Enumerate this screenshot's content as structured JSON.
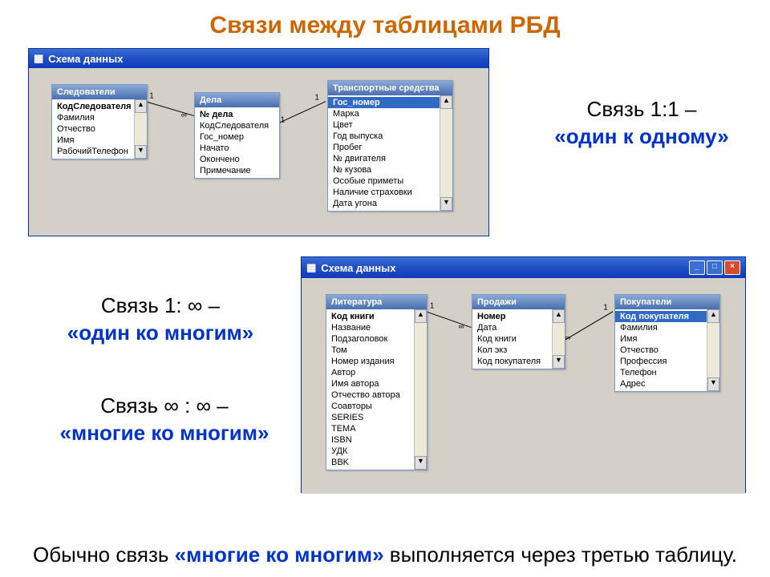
{
  "title": "Связи между таблицами РБД",
  "window1": {
    "title": "Схема данных",
    "tables": {
      "t1": {
        "header": "Следователи",
        "fields": [
          "КодСледователя",
          "Фамилия",
          "Отчество",
          "Имя",
          "РабочийТелефон"
        ]
      },
      "t2": {
        "header": "Дела",
        "fields": [
          "№ дела",
          "КодСледователя",
          "Гос_номер",
          "Начато",
          "Окончено",
          "Примечание"
        ]
      },
      "t3": {
        "header": "Транспортные средства",
        "fields": [
          "Гос_номер",
          "Марка",
          "Цвет",
          "Год выпуска",
          "Пробег",
          "№ двигателя",
          "№ кузова",
          "Особые приметы",
          "Наличие страховки",
          "Дата угона"
        ]
      }
    },
    "rel": {
      "l11": "1",
      "linf": "∞",
      "l12": "1",
      "l21": "1"
    }
  },
  "window2": {
    "title": "Схема данных",
    "tables": {
      "t1": {
        "header": "Литература",
        "fields": [
          "Код книги",
          "Название",
          "Подзаголовок",
          "Том",
          "Номер издания",
          "Автор",
          "Имя автора",
          "Отчество автора",
          "Соавторы",
          "SERIES",
          "TEMA",
          "ISBN",
          "УДК",
          "BBK"
        ]
      },
      "t2": {
        "header": "Продажи",
        "fields": [
          "Номер",
          "Дата",
          "Код книги",
          "Кол экз",
          "Код покупателя"
        ]
      },
      "t3": {
        "header": "Покупатели",
        "fields": [
          "Код покупателя",
          "Фамилия",
          "Имя",
          "Отчество",
          "Профессия",
          "Телефон",
          "Адрес"
        ]
      }
    },
    "rel": {
      "l11": "1",
      "linf1": "∞",
      "linf2": "∞",
      "l12": "1"
    }
  },
  "captions": {
    "c1a": "Связь 1:1 –",
    "c1b": "«один к одному»",
    "c2a": "Связь 1: ∞ –",
    "c2b": "«один ко многим»",
    "c3a": "Связь ∞ : ∞ –",
    "c3b": "«многие ко многим»"
  },
  "footer": {
    "a": "Обычно связь ",
    "b": "«многие ко многим»",
    "c": " выполняется через третью таблицу."
  },
  "icons": {
    "min": "_",
    "max": "□",
    "close": "×",
    "up": "▲",
    "down": "▼",
    "app": "▦"
  }
}
